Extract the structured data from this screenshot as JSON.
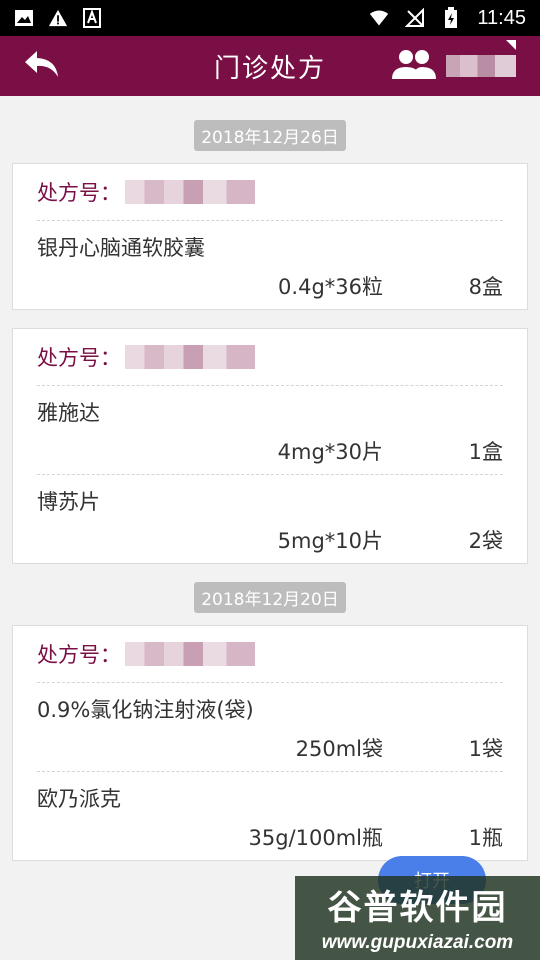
{
  "status_bar": {
    "time": "11:45",
    "icons": [
      "image-icon",
      "warning-icon",
      "font-icon",
      "wifi-icon",
      "no-sim-icon",
      "battery-charging-icon"
    ]
  },
  "app_bar": {
    "title": "门诊处方",
    "back_icon": "back-arrow-icon",
    "user_icon": "people-icon"
  },
  "groups": [
    {
      "date": "2018年12月26日",
      "prescriptions": [
        {
          "rx_label": "处方号：",
          "medicines": [
            {
              "name": "银丹心脑通软胶囊",
              "spec": "0.4g*36粒",
              "qty": "8盒"
            }
          ]
        },
        {
          "rx_label": "处方号：",
          "medicines": [
            {
              "name": "雅施达",
              "spec": "4mg*30片",
              "qty": "1盒"
            },
            {
              "name": "博苏片",
              "spec": "5mg*10片",
              "qty": "2袋"
            }
          ]
        }
      ]
    },
    {
      "date": "2018年12月20日",
      "prescriptions": [
        {
          "rx_label": "处方号：",
          "medicines": [
            {
              "name": "0.9%氯化钠注射液(袋)",
              "spec": "250ml袋",
              "qty": "1袋"
            },
            {
              "name": "欧乃派克",
              "spec": "35g/100ml瓶",
              "qty": "1瓶"
            }
          ]
        }
      ]
    }
  ],
  "floating_button": {
    "label": "打开"
  },
  "watermark": {
    "name": "谷普软件园",
    "url": "www.gupuxiazai.com"
  },
  "colors": {
    "brand": "#7a0f45",
    "fab": "#4a7ee8",
    "date_badge": "#bdbdbd"
  }
}
